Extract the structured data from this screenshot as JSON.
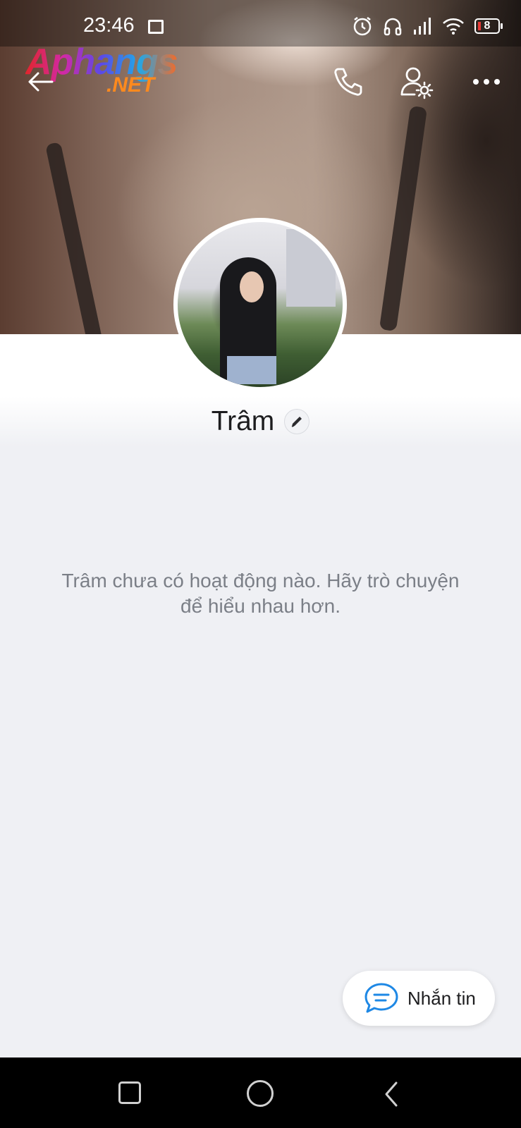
{
  "status_bar": {
    "time": "23:46",
    "battery": "8",
    "icons": [
      "gallery-icon",
      "alarm-icon",
      "headphones-icon",
      "signal-icon",
      "wifi-icon",
      "battery-icon"
    ]
  },
  "watermark": {
    "main": "Aphangs",
    "sub": ".NET"
  },
  "top_bar": {
    "icons": [
      "back-arrow-icon",
      "phone-icon",
      "user-settings-icon",
      "more-dots-icon"
    ]
  },
  "profile": {
    "name": "Trâm",
    "empty_activity": "Trâm chưa có hoạt động nào. Hãy trò chuyện để hiểu nhau hơn."
  },
  "message_button": {
    "label": "Nhắn tin",
    "icon": "chat-bubble-icon",
    "accent": "#1e88e5"
  },
  "nav_bar": {
    "icons": [
      "recent-apps-icon",
      "home-icon",
      "back-icon"
    ]
  }
}
